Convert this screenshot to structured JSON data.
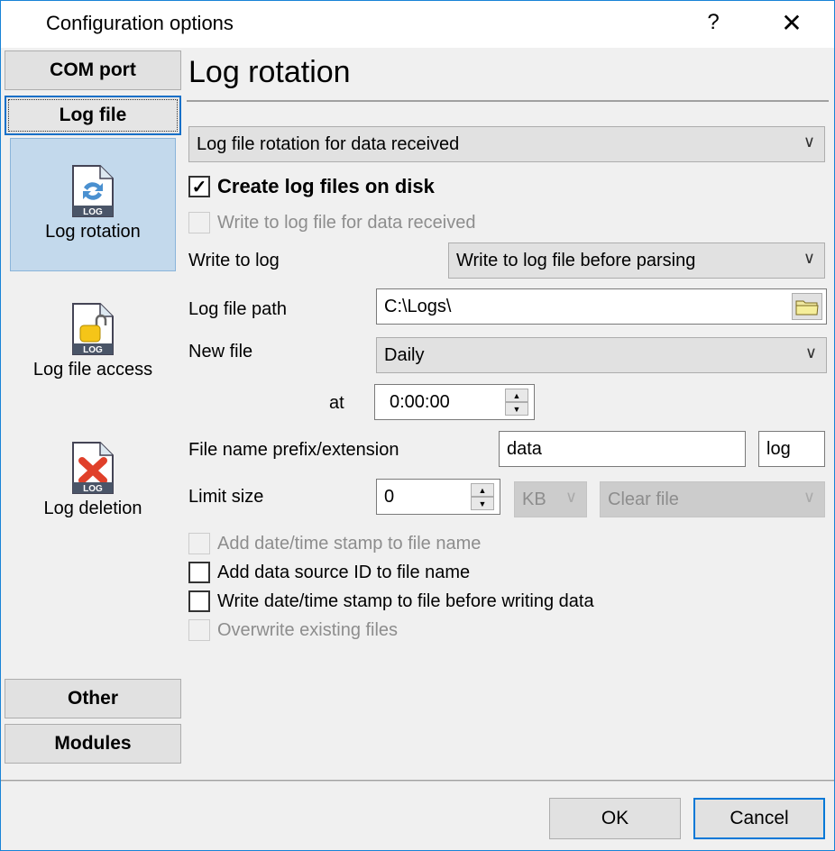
{
  "window": {
    "title": "Configuration options",
    "help_label": "?",
    "close_label": "✕"
  },
  "sidebar": {
    "sections": [
      {
        "label": "COM port"
      },
      {
        "label": "Log file"
      },
      {
        "label": "Other"
      },
      {
        "label": "Modules"
      }
    ],
    "log_file_items": [
      {
        "label": "Log rotation",
        "icon": "log-rotation-icon",
        "selected": true
      },
      {
        "label": "Log file access",
        "icon": "log-lock-icon",
        "selected": false
      },
      {
        "label": "Log deletion",
        "icon": "log-delete-icon",
        "selected": false
      }
    ],
    "icon_badge": "LOG"
  },
  "main": {
    "header": "Log rotation",
    "rotation_mode": {
      "value": "Log file rotation for data received"
    },
    "create_log_files": {
      "label": "Create log files on disk",
      "checked": true,
      "check_glyph": "✓"
    },
    "write_for_received": {
      "label": "Write to log file for data received",
      "checked": false,
      "disabled": true
    },
    "write_to_log": {
      "label": "Write to log",
      "value": "Write to log file before parsing"
    },
    "log_file_path": {
      "label": "Log file path",
      "value": "C:\\Logs\\"
    },
    "new_file": {
      "label": "New file",
      "value": "Daily"
    },
    "at": {
      "label": "at",
      "value": "0:00:00"
    },
    "file_name": {
      "label": "File name prefix/extension",
      "prefix": "data",
      "extension": "log"
    },
    "limit_size": {
      "label": "Limit size",
      "value": "0",
      "unit": "KB",
      "action": "Clear file"
    },
    "options": [
      {
        "label": "Add date/time stamp to file name",
        "checked": false,
        "disabled": true
      },
      {
        "label": "Add data source ID to file name",
        "checked": false,
        "disabled": false
      },
      {
        "label": "Write date/time stamp to file before writing data",
        "checked": false,
        "disabled": false
      },
      {
        "label": "Overwrite existing files",
        "checked": false,
        "disabled": true
      }
    ],
    "chevron": "∨",
    "spin_up": "▲",
    "spin_down": "▼"
  },
  "footer": {
    "ok_label": "OK",
    "cancel_label": "Cancel"
  }
}
